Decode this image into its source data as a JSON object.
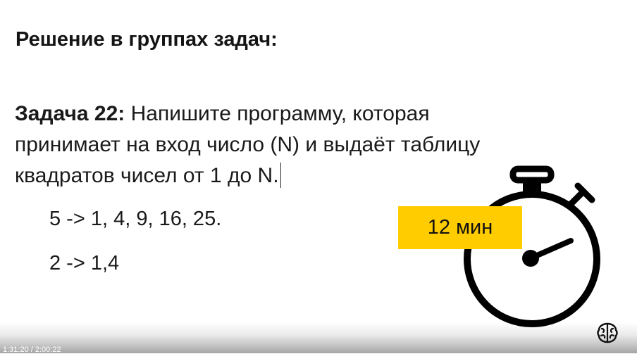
{
  "slide": {
    "heading": "Решение в группах задач:",
    "task": {
      "label": "Задача 22:",
      "line1": "Напишите программу, которая",
      "line2": "принимает на вход число (N) и выдаёт таблицу",
      "line3": "квадратов чисел от 1 до N."
    },
    "examples": [
      "5 -> 1, 4, 9, 16, 25.",
      "2 -> 1,4"
    ],
    "timer": {
      "label": "12 мин",
      "icon": "stopwatch-icon",
      "accent_color": "#ffcc00"
    }
  },
  "player": {
    "timecode": "1:31:20 / 2:00:22",
    "logo_icon": "brain-logo-icon"
  }
}
